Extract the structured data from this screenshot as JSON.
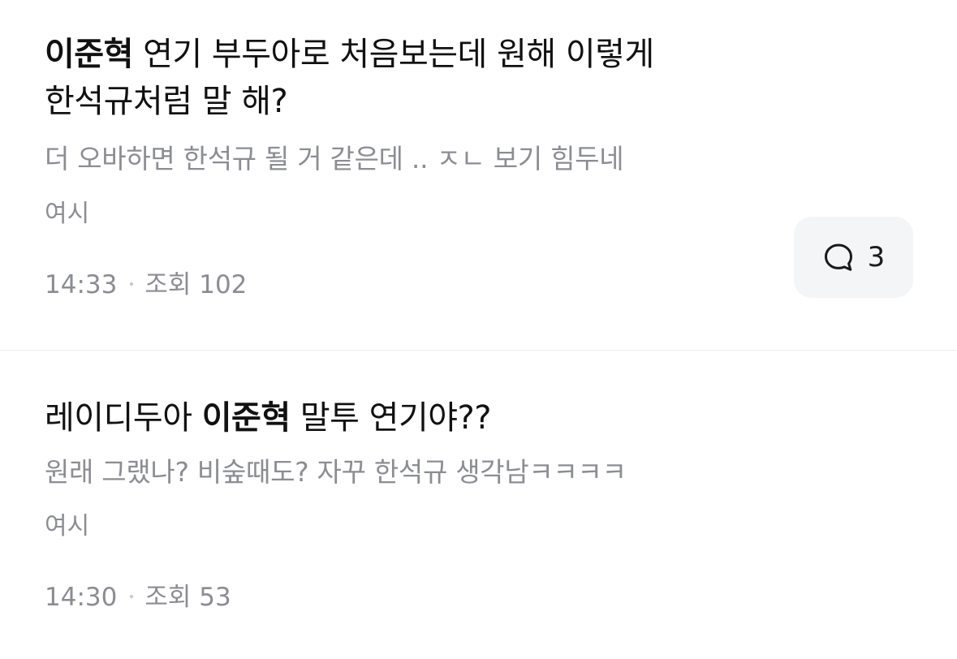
{
  "posts": [
    {
      "title_highlight": "이준혁",
      "title_rest_line1": " 연기 부두아로 처음보는데 원해 이렇게",
      "title_line2": "한석규처럼 말 해?",
      "snippet": "더 오바하면 한석규 될 거 같은데 .. ㅈㄴ 보기 힘두네",
      "board": "여시",
      "time": "14:33",
      "views": "조회 102",
      "comment_count": "3",
      "comment_icon": "speech-bubble-icon"
    },
    {
      "title_pre": "레이디두아 ",
      "title_highlight": "이준혁",
      "title_post": " 말투 연기야??",
      "snippet": "원래 그랬나? 비숲때도? 자꾸 한석규 생각남ㅋㅋㅋㅋ",
      "board": "여시",
      "time": "14:30",
      "views": "조회 53"
    }
  ]
}
